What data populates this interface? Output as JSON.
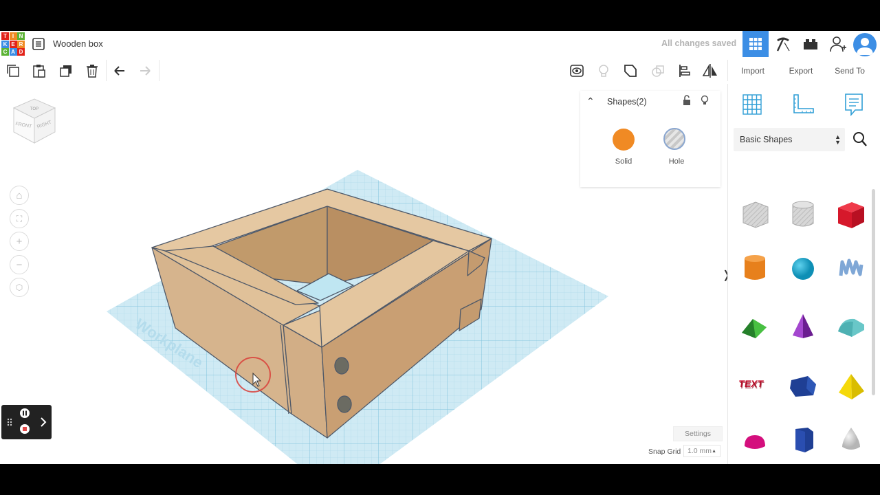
{
  "app": {
    "logo_letters": [
      "T",
      "I",
      "N",
      "K",
      "E",
      "R",
      "C",
      "A",
      "D"
    ],
    "logo_colors": [
      "#e2231a",
      "#f08a24",
      "#5cb335",
      "#3c8ee5",
      "#e2231a",
      "#f08a24",
      "#5cb335",
      "#3c8ee5",
      "#e2231a"
    ],
    "document_title": "Wooden box",
    "save_status": "All changes saved"
  },
  "toolbar": {
    "import_label": "Import",
    "export_label": "Export",
    "send_to_label": "Send To"
  },
  "viewcube": {
    "top": "TOP",
    "front": "FRONT",
    "right": "RIGHT"
  },
  "inspector": {
    "title": "Shapes(2)",
    "solid_label": "Solid",
    "hole_label": "Hole",
    "solid_color": "#f08a24"
  },
  "workplane": {
    "label": "Workplane",
    "settings_label": "Settings",
    "snap_grid_label": "Snap Grid",
    "snap_grid_value": "1.0 mm"
  },
  "panel": {
    "category": "Basic Shapes",
    "shapes": [
      "box-hole",
      "cylinder-hole",
      "box",
      "cylinder",
      "sphere",
      "scribble",
      "roof",
      "cone",
      "round-roof",
      "text",
      "polygon",
      "pyramid",
      "half-sphere",
      "hexagonal-prism",
      "paraboloid"
    ]
  },
  "colors": {
    "accent": "#3c8ee5",
    "wood": "#c9a57c",
    "workplane": "#cfeaf4"
  }
}
